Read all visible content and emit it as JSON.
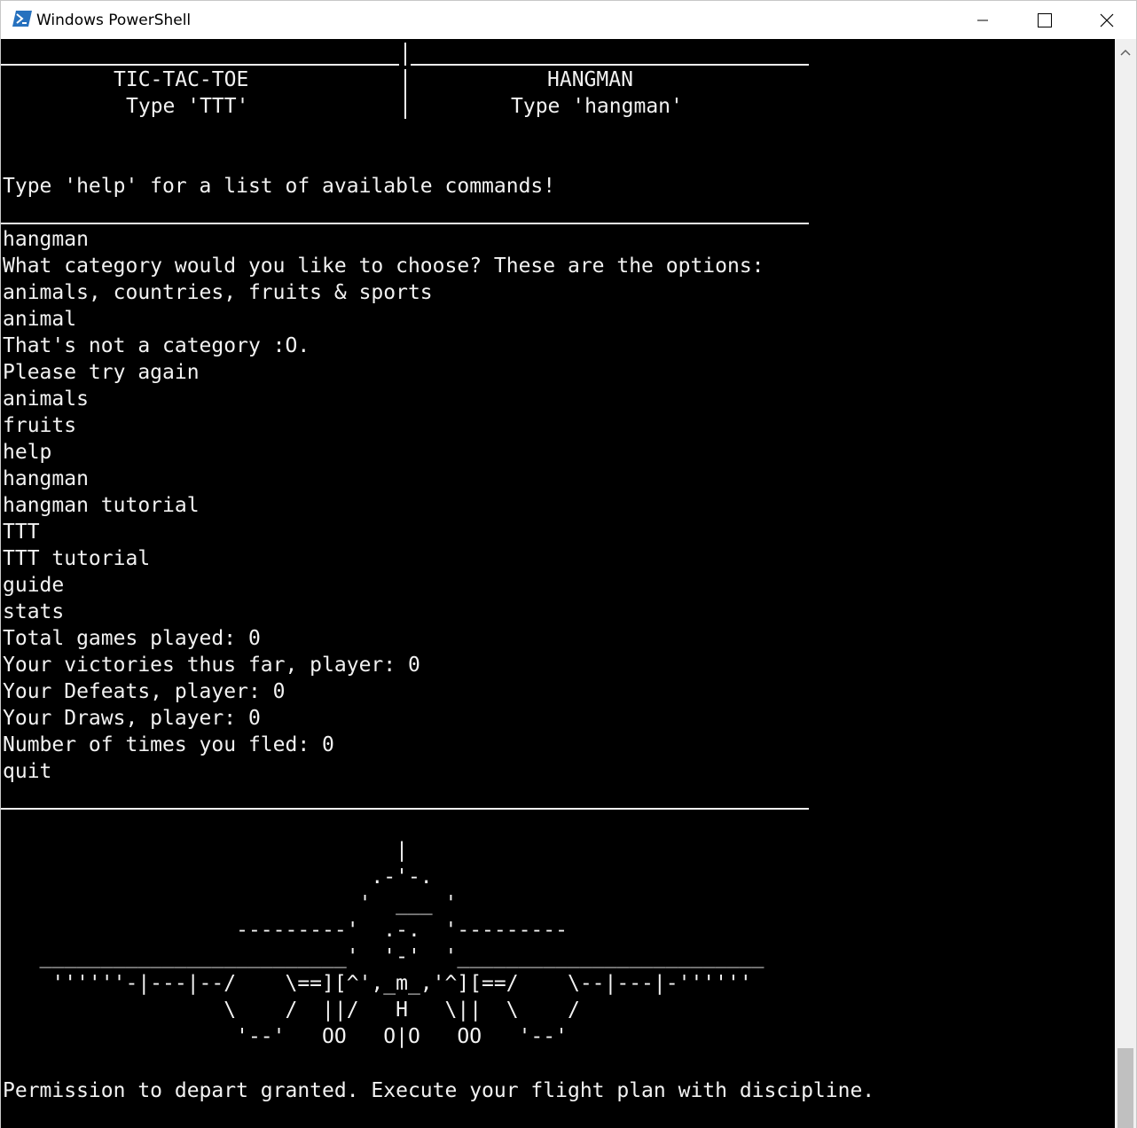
{
  "window": {
    "title": "Windows PowerShell",
    "icon": "powershell-icon",
    "controls": {
      "minimize": "minimize-icon",
      "maximize": "maximize-icon",
      "close": "close-icon"
    }
  },
  "menu_panel": {
    "left_title": "TIC-TAC-TOE",
    "left_hint": "Type 'TTT'",
    "right_title": "HANGMAN",
    "right_hint": "Type 'hangman'"
  },
  "help_prompt": "Type 'help' for a list of available commands!",
  "console_lines": [
    "hangman",
    "What category would you like to choose? These are the options:",
    "animals, countries, fruits & sports",
    "animal",
    "That's not a category :O.",
    "Please try again",
    "animals",
    "fruits",
    "help",
    "hangman",
    "hangman tutorial",
    "TTT",
    "TTT tutorial",
    "guide",
    "stats",
    "Total games played: 0",
    "Your victories thus far, player: 0",
    "Your Defeats, player: 0",
    "Your Draws, player: 0",
    "Number of times you fled: 0",
    "quit"
  ],
  "ascii_art": [
    "                                |",
    "                              .-'-.",
    "                             '  ___ '",
    "                   ---------'  .-.  '---------",
    "   _________________________'  '-'  '_________________________",
    "    ''''''-|---|--/    \\==][^',_m_,'^][==/    \\--|---|-''''''",
    "                  \\    /  ||/   H   \\||  \\    /",
    "                   '--'   OO   O|O   OO   '--'"
  ],
  "final_message": "Permission to depart granted. Execute your flight plan with discipline.",
  "colors": {
    "console_bg": "#000000",
    "console_fg": "#f2f2f2",
    "titlebar_bg": "#ffffff",
    "scrollbar_bg": "#f0f0f0",
    "scroll_thumb": "#c0c0c0",
    "powershell_blue": "#2671be"
  }
}
